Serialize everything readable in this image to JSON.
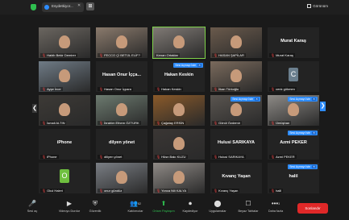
{
  "topbar": {
    "tab_label": "Esydetkiyor...",
    "close_glyph": "✕",
    "view_glyph": "⊞",
    "gallery_label": "Görünüm"
  },
  "tiles": [
    {
      "name": "Habib Bekir Demirer",
      "type": "video",
      "bg": "#6b6660",
      "muted": true
    },
    {
      "name": "FECCO Çİ BETÜL ELİF?",
      "type": "video",
      "bg": "#8a7a6c",
      "muted": true
    },
    {
      "name": "Kenan Ortaklar",
      "type": "video",
      "bg": "#807a75",
      "active": true
    },
    {
      "name": "HASAN ŞAPİLAR",
      "type": "video",
      "bg": "#6a5a4c",
      "muted": true
    },
    {
      "name": "Murat Karaş",
      "type": "text",
      "label": "Murat Karaş",
      "muted": true
    },
    {
      "name": "Ayşe İnce",
      "type": "video",
      "bg": "#6f7b86",
      "muted": true
    },
    {
      "name": "Hasan Onur İçpara",
      "type": "text",
      "label": "Hasan Onur İçça...",
      "muted": true
    },
    {
      "name": "Hakan Keskin",
      "type": "text",
      "label": "Hakan Keskin",
      "muted": true,
      "badge": "Sesi Açmayı İste"
    },
    {
      "name": "İlkan Türkoğlu",
      "type": "video",
      "bg": "#7a6a5c",
      "muted": true
    },
    {
      "name": "cenk gökmen",
      "type": "avatar",
      "letter": "C",
      "color": "#6b7f8e",
      "muted": true
    },
    {
      "name": "İsmail ALTIN",
      "type": "video",
      "bg": "#3d3a36",
      "muted": true
    },
    {
      "name": "İbrahim Ethem ÖZTÜRK",
      "type": "video",
      "bg": "#6c7a6f",
      "muted": true
    },
    {
      "name": "Çağatay ERSİN",
      "type": "video",
      "bg": "#8a5a2a",
      "muted": true
    },
    {
      "name": "Gönül Özdemir",
      "type": "video",
      "bg": "#5a5550",
      "muted": true,
      "badge": "Sesi Açmayı İste"
    },
    {
      "name": "Ümüşhan",
      "type": "video",
      "bg": "#8d8a86",
      "muted": true,
      "badge": "Sesi Açmayı İste"
    },
    {
      "name": "iPhone",
      "type": "text",
      "label": "iPhone",
      "muted": true
    },
    {
      "name": "diliyen yönet",
      "type": "text",
      "label": "dilyen yönet",
      "muted": true
    },
    {
      "name": "Hüsn Bakı KUZU",
      "type": "video",
      "bg": "#3a3634",
      "muted": true
    },
    {
      "name": "Hulusi SARIKAYA",
      "type": "text",
      "label": "Hulusi SARIKAYA",
      "muted": true
    },
    {
      "name": "Azmi PEKER",
      "type": "text",
      "label": "Azmi PEKER",
      "muted": true,
      "badge": "Sesi Açmayı İste"
    },
    {
      "name": "Okul Haleri",
      "type": "avatar",
      "letter": "O",
      "color": "#6fbf3f",
      "muted": true
    },
    {
      "name": "onur gündüz",
      "type": "video",
      "bg": "#7a7e84",
      "muted": true
    },
    {
      "name": "Yonca Nili KALYA",
      "type": "video",
      "bg": "#8f8a86",
      "muted": true
    },
    {
      "name": "Kıvanç Yaşan",
      "type": "text",
      "label": "Kıvanç Yaşan",
      "muted": true
    },
    {
      "name": "halil",
      "type": "text",
      "label": "halil",
      "muted": true,
      "badge": "Sesi Açmayı İste"
    }
  ],
  "badge_close": "✕",
  "nav": {
    "left": "❮",
    "right": "❯"
  },
  "toolbar": {
    "items": [
      {
        "label": "Sesi aç",
        "icon": "🎤"
      },
      {
        "label": "Videoyu Durdur",
        "icon": "▶"
      },
      {
        "label": "Güvenlik",
        "icon": "⛨"
      },
      {
        "label": "Katılımcılar",
        "icon": "👥",
        "count": "82"
      },
      {
        "label": "Ortam Paylaşım",
        "icon": "⬆",
        "green": true
      },
      {
        "label": "Kaydediyor",
        "icon": "⏺"
      },
      {
        "label": "Uygulamalar",
        "icon": "⬤"
      },
      {
        "label": "Beyaz Tahtalar",
        "icon": "☐"
      },
      {
        "label": "Daha fazla",
        "icon": "•••",
        "count": "3"
      }
    ],
    "end_label": "Sonlandır"
  }
}
